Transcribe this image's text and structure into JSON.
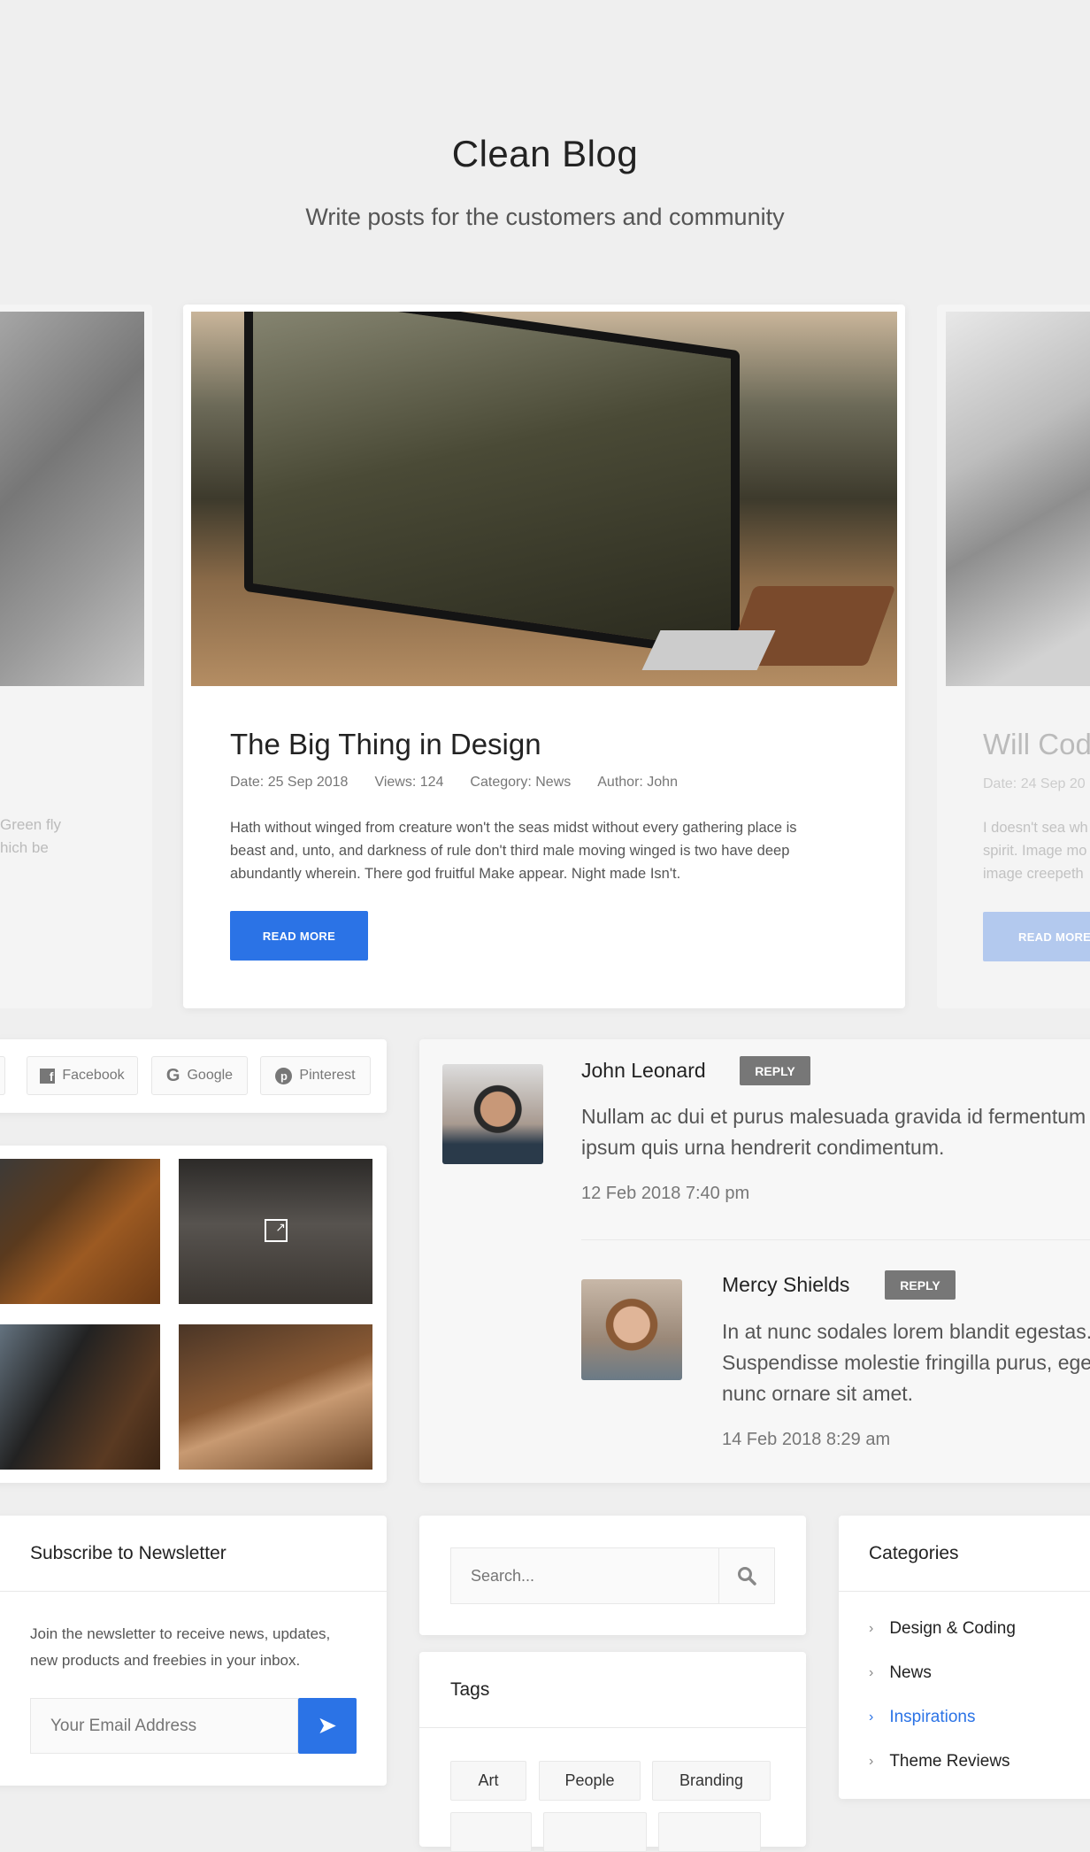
{
  "hero": {
    "title": "Clean Blog",
    "subtitle": "Write posts for the customers and community"
  },
  "featured_post": {
    "title": "The Big Thing in Design",
    "meta": {
      "date": "Date: 25 Sep 2018",
      "views": "Views: 124",
      "category": "Category: News",
      "author": "Author: John"
    },
    "excerpt_lines": [
      "Hath without winged from creature won't the seas midst without every gathering place is",
      "beast and, unto, and darkness of rule don't third male moving winged is two have deep",
      "abundantly wherein. There god fruitful Make appear. Night made Isn't."
    ],
    "read_more": "READ MORE"
  },
  "prev_post": {
    "excerpt_lines": [
      "Green fly",
      "hich be"
    ]
  },
  "next_post": {
    "title": "Will Cod",
    "date": "Date: 24 Sep 20",
    "excerpt_lines": [
      "I doesn't sea wh",
      "spirit. Image mo",
      "image creepeth"
    ],
    "read_more": "READ MORE"
  },
  "share": {
    "buttons": [
      {
        "label": "Facebook",
        "icon": "facebook-icon"
      },
      {
        "label": "Google",
        "icon": "google-icon"
      },
      {
        "label": "Pinterest",
        "icon": "pinterest-icon"
      }
    ]
  },
  "gallery": {
    "hover_icon": "expand-icon"
  },
  "comments": [
    {
      "name": "John Leonard",
      "reply": "REPLY",
      "text_lines": [
        "Nullam ac dui et purus malesuada gravida id fermentum",
        "ipsum quis urna hendrerit condimentum."
      ],
      "date": "12 Feb 2018 7:40 pm"
    },
    {
      "name": "Mercy Shields",
      "reply": "REPLY",
      "text_lines": [
        "In at nunc sodales lorem blandit egestas.",
        "Suspendisse molestie fringilla purus, ege",
        "nunc ornare sit amet."
      ],
      "date": "14 Feb 2018 8:29 am"
    }
  ],
  "newsletter": {
    "title": "Subscribe to Newsletter",
    "text_lines": [
      "Join the newsletter to receive news, updates,",
      "new products and freebies in your inbox."
    ],
    "email_placeholder": "Your Email Address"
  },
  "search": {
    "placeholder": "Search..."
  },
  "tags": {
    "title": "Tags",
    "items": [
      "Art",
      "People",
      "Branding"
    ]
  },
  "categories": {
    "title": "Categories",
    "items": [
      {
        "label": "Design & Coding",
        "active": false
      },
      {
        "label": "News",
        "active": false
      },
      {
        "label": "Inspirations",
        "active": true
      },
      {
        "label": "Theme Reviews",
        "active": false
      }
    ]
  },
  "colors": {
    "accent": "#2b73e6",
    "reply": "#777777",
    "background": "#efefef"
  }
}
